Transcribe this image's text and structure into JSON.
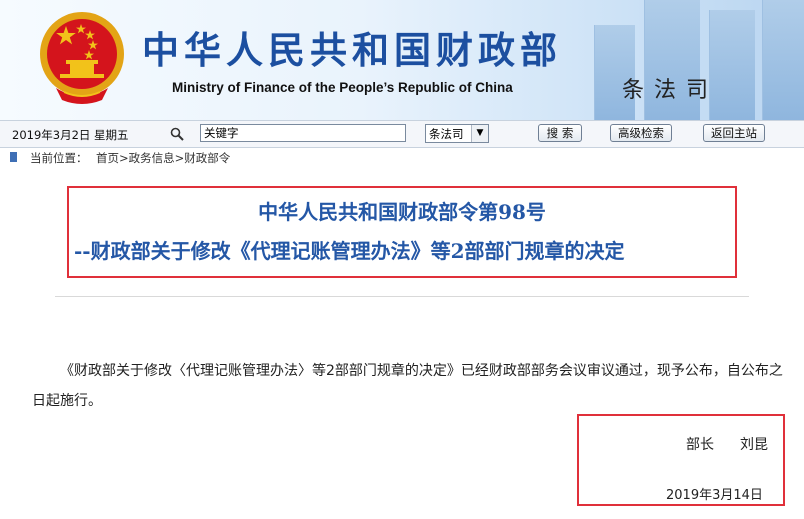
{
  "header": {
    "title_cn": "中华人民共和国财政部",
    "title_en": "Ministry of Finance of the People’s Republic of China",
    "department": "条法司",
    "emblem_icon": "national-emblem-icon"
  },
  "toolbar": {
    "date": "2019年3月2日 星期五",
    "search_placeholder": "关键字",
    "search_value": "关键字",
    "scope_selected": "条法司",
    "search_label": "搜 索",
    "advanced_label": "高级检索",
    "home_label": "返回主站"
  },
  "breadcrumb": {
    "label": "当前位置：",
    "path": "首页>政务信息>财政部令"
  },
  "article": {
    "title_line1": "中华人民共和国财政部令第98号",
    "title_line2": "--财政部关于修改《代理记账管理办法》等2部部门规章的决定",
    "body": "《财政部关于修改〈代理记账管理办法〉等2部部门规章的决定》已经财政部部务会议审议通过，现予公布，自公布之日起施行。",
    "sign_title": "部长",
    "sign_name": "刘昆",
    "sign_date": "2019年3月14日"
  },
  "colors": {
    "title_blue": "#1c4fa0",
    "heading_blue": "#2457a6",
    "highlight_red": "#e0303a",
    "emblem_red": "#d4141c",
    "emblem_gold": "#f2c21a"
  }
}
